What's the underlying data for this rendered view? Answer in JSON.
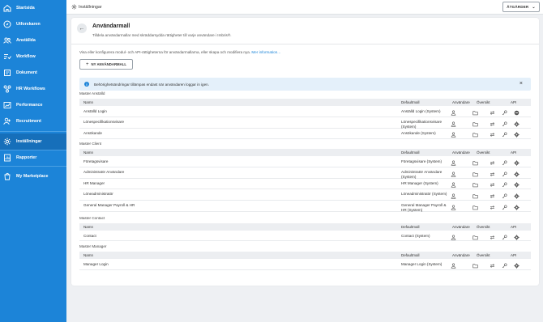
{
  "sidebar": {
    "items": [
      {
        "label": "Startsida",
        "icon": "home-icon"
      },
      {
        "label": "Utforskaren",
        "icon": "compass-icon"
      },
      {
        "label": "Anställda",
        "icon": "people-icon"
      },
      {
        "label": "Workflow",
        "icon": "workflow-icon"
      },
      {
        "label": "Dokument",
        "icon": "document-icon"
      },
      {
        "label": "HR Workflows",
        "icon": "hr-workflows-icon"
      },
      {
        "label": "Performance",
        "icon": "performance-icon"
      },
      {
        "label": "Recruitment",
        "icon": "recruitment-icon"
      },
      {
        "label": "Inställningar",
        "icon": "gear-icon",
        "active": true
      },
      {
        "label": "Rapporter",
        "icon": "reports-icon"
      },
      {
        "label": "My Marketplace",
        "icon": "marketplace-icon"
      }
    ]
  },
  "topbar": {
    "breadcrumb": "Inställningar",
    "actions_label": "ÅTGÄRDER"
  },
  "card": {
    "title": "Användarmall",
    "subtitle": "Tilldela användarmallar med skräddarsydda rättigheter till varje användare i Imbris®.",
    "intro": "Visa eller konfigurera modul- och API-rättigheterna för användarmallarna, eller skapa och modifiera nya.",
    "intro_link": "Mer information...",
    "new_button": "NY ANVÄNDARMALL",
    "info_text": "Behörighetsändringar tillämpas endast när användaren loggar in igen."
  },
  "columns": {
    "name": "Namn",
    "default": "Defaultmall",
    "users": "Användare",
    "overview": "Översikt",
    "api": "API"
  },
  "groups": [
    {
      "title": "Master Anställd",
      "rows": [
        {
          "name": "Anställd Login",
          "default": "Anställd Login (System)"
        },
        {
          "name": "Lönespecifikationsvisare",
          "default": "Lönespecifikationsvisare (System)"
        },
        {
          "name": "Ansökande",
          "default": "Ansökande (System)"
        }
      ]
    },
    {
      "title": "Master Client",
      "rows": [
        {
          "name": "Företagsvisare",
          "default": "Företagsvisare (System)"
        },
        {
          "name": "Administratör Användare",
          "default": "Administratör Användare (System)"
        },
        {
          "name": "HR Manager",
          "default": "HR Manager (System)"
        },
        {
          "name": "Löneadministratör",
          "default": "Löneadministratör (System)"
        },
        {
          "name": "General Manager Payroll & HR",
          "default": "General Manager Payroll & HR (System)"
        }
      ]
    },
    {
      "title": "Master Contact",
      "rows": [
        {
          "name": "Contact",
          "default": "Contact (System)"
        }
      ]
    },
    {
      "title": "Master Manager",
      "rows": [
        {
          "name": "Manager Login",
          "default": "Manager Login (System)"
        }
      ]
    }
  ],
  "colors": {
    "sidebar": "#1c84d8",
    "sidebar_active": "#166fba",
    "link": "#1c84d8",
    "info_bg": "#e4f0fa"
  }
}
